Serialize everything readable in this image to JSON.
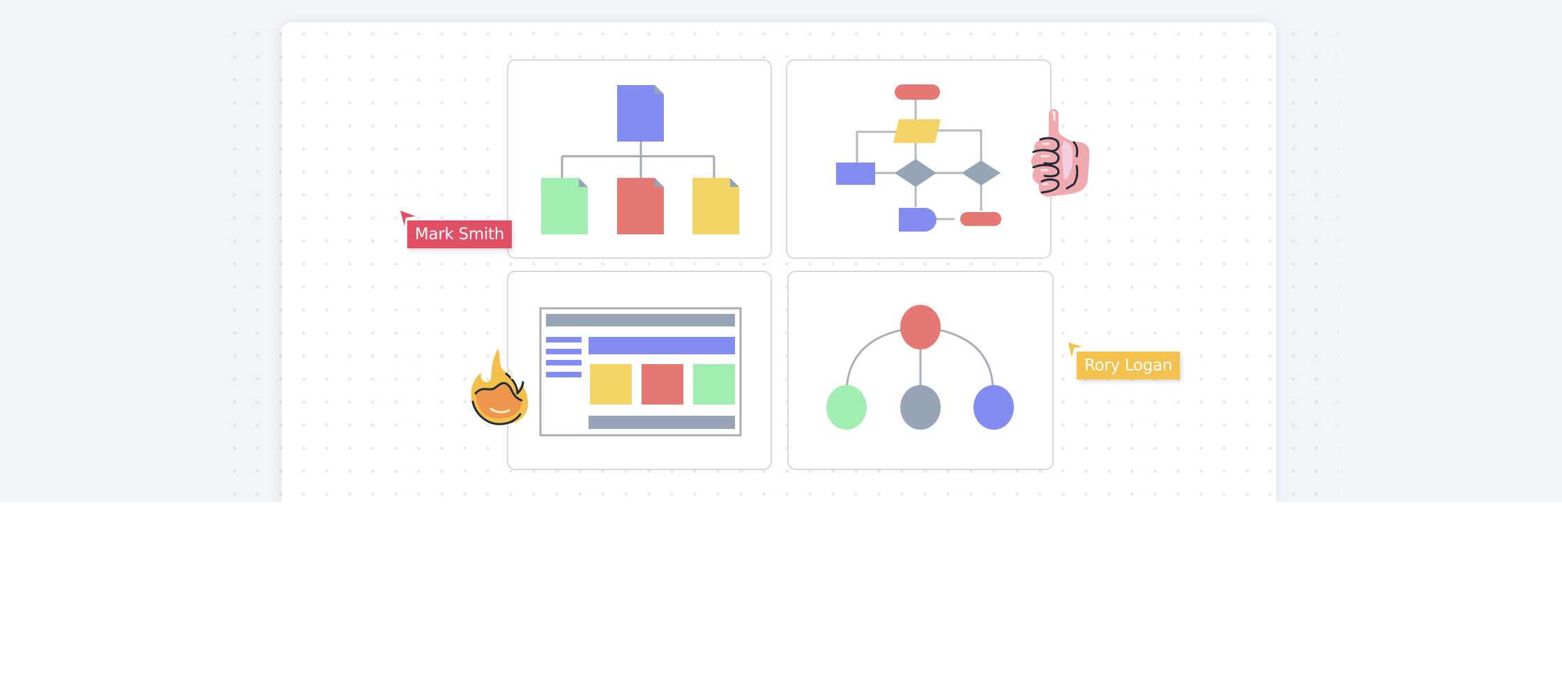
{
  "canvas": {
    "background": "#f1f4f8",
    "board_background": "#ffffff"
  },
  "templates": [
    {
      "name": "document-hierarchy",
      "shapes": [
        "blue-document",
        "green-document",
        "red-document",
        "yellow-document"
      ]
    },
    {
      "name": "flowchart",
      "shapes": [
        "red-terminator",
        "yellow-parallelogram",
        "blue-process",
        "gray-decision",
        "gray-decision",
        "blue-delay",
        "red-terminator"
      ]
    },
    {
      "name": "wireframe",
      "shapes": [
        "gray-header-bar",
        "blue-nav-lines",
        "blue-banner",
        "yellow-tile",
        "red-tile",
        "green-tile",
        "gray-footer-bar"
      ]
    },
    {
      "name": "tree-diagram",
      "shapes": [
        "red-root-node",
        "green-node",
        "gray-node",
        "blue-node"
      ]
    }
  ],
  "collaborators": [
    {
      "name": "Mark Smith",
      "color": "#e04f64"
    },
    {
      "name": "Rory Logan",
      "color": "#f2c14e"
    }
  ],
  "reactions": [
    {
      "icon": "thumbs-up-icon"
    },
    {
      "icon": "fire-icon"
    }
  ],
  "colors": {
    "blue": "#838cf1",
    "green": "#a2edb2",
    "red": "#e57873",
    "yellow": "#f4d466",
    "gray": "#97a4b6",
    "line": "#a9b0b9"
  }
}
